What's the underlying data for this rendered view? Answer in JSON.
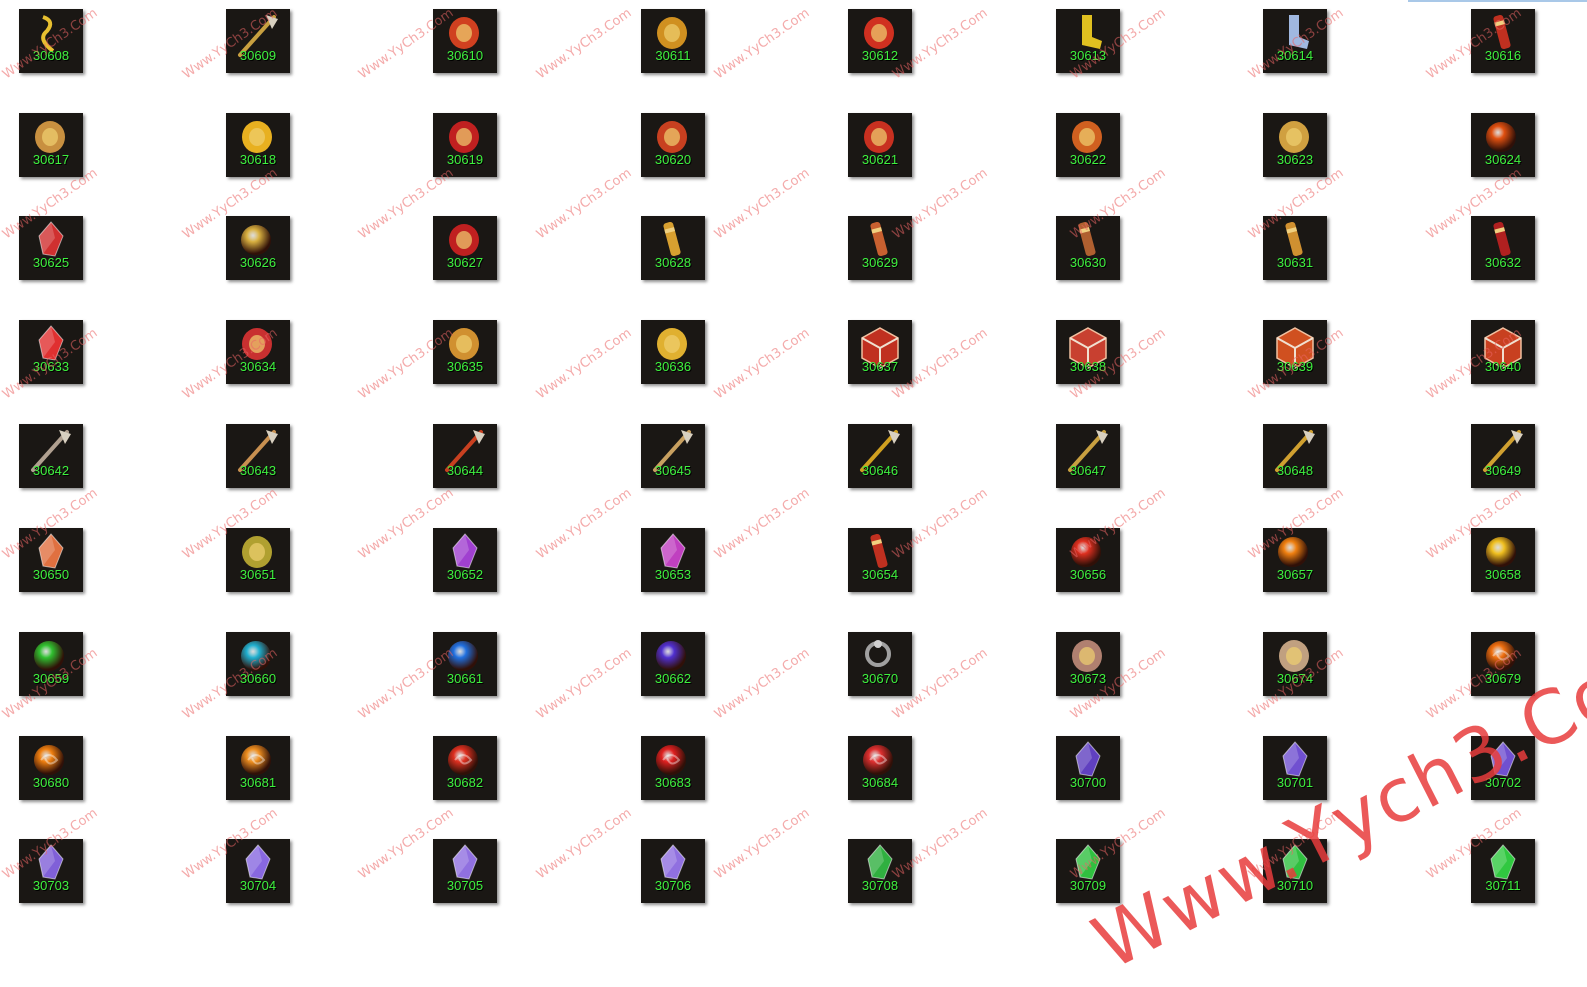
{
  "items": [
    {
      "id": "30608",
      "icon": "ribbon-icon",
      "color": "#e8c030"
    },
    {
      "id": "30609",
      "icon": "wand-icon",
      "color": "#c8a040"
    },
    {
      "id": "30610",
      "icon": "flower-bundle-icon",
      "color": "#d04020"
    },
    {
      "id": "30611",
      "icon": "gold-emblem-icon",
      "color": "#d09020"
    },
    {
      "id": "30612",
      "icon": "red-seal-icon",
      "color": "#d03020"
    },
    {
      "id": "30613",
      "icon": "stocking-gold-icon",
      "color": "#e0c020"
    },
    {
      "id": "30614",
      "icon": "stocking-blue-icon",
      "color": "#a0b8e0"
    },
    {
      "id": "30616",
      "icon": "firecracker-icon",
      "color": "#c03020"
    },
    {
      "id": "30617",
      "icon": "treasure-chest-icon",
      "color": "#c89040"
    },
    {
      "id": "30618",
      "icon": "gold-ingot-icon",
      "color": "#e8b020"
    },
    {
      "id": "30619",
      "icon": "red-pouch-icon",
      "color": "#c02020"
    },
    {
      "id": "30620",
      "icon": "lucky-bag-icon",
      "color": "#c84020"
    },
    {
      "id": "30621",
      "icon": "chinese-knot-icon",
      "color": "#c83020"
    },
    {
      "id": "30622",
      "icon": "lantern-icon",
      "color": "#d06020"
    },
    {
      "id": "30623",
      "icon": "red-envelope-icon",
      "color": "#d0a040"
    },
    {
      "id": "30624",
      "icon": "fire-orb-icon",
      "color": "#e05010"
    },
    {
      "id": "30625",
      "icon": "red-gem-icon",
      "color": "#d03030"
    },
    {
      "id": "30626",
      "icon": "gold-sphere-icon",
      "color": "#d8b040"
    },
    {
      "id": "30627",
      "icon": "banner-shield-icon",
      "color": "#c02020"
    },
    {
      "id": "30628",
      "icon": "scroll-gold-icon",
      "color": "#d8a030"
    },
    {
      "id": "30629",
      "icon": "scroll-blue-icon",
      "color": "#c86030"
    },
    {
      "id": "30630",
      "icon": "scroll-red-icon",
      "color": "#b06030"
    },
    {
      "id": "30631",
      "icon": "scroll-amber-icon",
      "color": "#d09030"
    },
    {
      "id": "30632",
      "icon": "firecracker-bundle-icon",
      "color": "#b02020"
    },
    {
      "id": "30633",
      "icon": "ruby-icon",
      "color": "#e03030"
    },
    {
      "id": "30634",
      "icon": "winged-amulet-icon",
      "color": "#c83030"
    },
    {
      "id": "30635",
      "icon": "crest-shield-icon",
      "color": "#d09030"
    },
    {
      "id": "30636",
      "icon": "golden-ram-icon",
      "color": "#e0b030"
    },
    {
      "id": "30637",
      "icon": "red-cube-icon",
      "color": "#c03020"
    },
    {
      "id": "30638",
      "icon": "red-cube-silver-icon",
      "color": "#c84030"
    },
    {
      "id": "30639",
      "icon": "red-cube-gold-icon",
      "color": "#d05020"
    },
    {
      "id": "30640",
      "icon": "red-cube-star-icon",
      "color": "#c84020"
    },
    {
      "id": "30642",
      "icon": "battle-axe-icon",
      "color": "#b0a090"
    },
    {
      "id": "30643",
      "icon": "trident-icon",
      "color": "#c89050"
    },
    {
      "id": "30644",
      "icon": "flame-halberd-icon",
      "color": "#c84020"
    },
    {
      "id": "30645",
      "icon": "double-axe-icon",
      "color": "#c8a060"
    },
    {
      "id": "30646",
      "icon": "golden-blade-icon",
      "color": "#d0a020"
    },
    {
      "id": "30647",
      "icon": "scythe-icon",
      "color": "#c8a040"
    },
    {
      "id": "30648",
      "icon": "golden-spear-icon",
      "color": "#d0a030"
    },
    {
      "id": "30649",
      "icon": "longsword-icon",
      "color": "#d0a030"
    },
    {
      "id": "30650",
      "icon": "rainbow-crystal-icon",
      "color": "#e07040"
    },
    {
      "id": "30651",
      "icon": "green-rune-icon",
      "color": "#b0a030"
    },
    {
      "id": "30652",
      "icon": "purple-gem-icon",
      "color": "#a040d0"
    },
    {
      "id": "30653",
      "icon": "violet-gem-icon",
      "color": "#c040c0"
    },
    {
      "id": "30654",
      "icon": "red-scroll-tag-icon",
      "color": "#c03020"
    },
    {
      "id": "30656",
      "icon": "red-orb-icon",
      "color": "#e03020"
    },
    {
      "id": "30657",
      "icon": "orange-orb-icon",
      "color": "#f08010"
    },
    {
      "id": "30658",
      "icon": "yellow-orb-icon",
      "color": "#f0c020"
    },
    {
      "id": "30659",
      "icon": "green-orb-icon",
      "color": "#30c030"
    },
    {
      "id": "30660",
      "icon": "cyan-orb-icon",
      "color": "#20b0d0"
    },
    {
      "id": "30661",
      "icon": "blue-orb-icon",
      "color": "#2070e0"
    },
    {
      "id": "30662",
      "icon": "indigo-orb-icon",
      "color": "#5030d0"
    },
    {
      "id": "30670",
      "icon": "silver-ring-icon",
      "color": "#a0a0a0"
    },
    {
      "id": "30673",
      "icon": "stone-claw-icon",
      "color": "#b08070"
    },
    {
      "id": "30674",
      "icon": "bone-relic-icon",
      "color": "#c0a080"
    },
    {
      "id": "30679",
      "icon": "orange-swirl-orb-icon",
      "color": "#f07010"
    },
    {
      "id": "30680",
      "icon": "orange-swirl-orb-2-icon",
      "color": "#f08010"
    },
    {
      "id": "30681",
      "icon": "orange-swirl-orb-3-icon",
      "color": "#f09020"
    },
    {
      "id": "30682",
      "icon": "red-swirl-orb-icon",
      "color": "#e03020"
    },
    {
      "id": "30683",
      "icon": "red-swirl-orb-2-icon",
      "color": "#e02020"
    },
    {
      "id": "30684",
      "icon": "red-swirl-orb-3-icon",
      "color": "#e03030"
    },
    {
      "id": "30700",
      "icon": "small-amethyst-icon",
      "color": "#6040c0"
    },
    {
      "id": "30701",
      "icon": "amethyst-icon",
      "color": "#7050d0"
    },
    {
      "id": "30702",
      "icon": "amethyst-2-icon",
      "color": "#7050d0"
    },
    {
      "id": "30703",
      "icon": "amethyst-3-icon",
      "color": "#8060d8"
    },
    {
      "id": "30704",
      "icon": "amethyst-4-icon",
      "color": "#8868e0"
    },
    {
      "id": "30705",
      "icon": "amethyst-5-icon",
      "color": "#9070e0"
    },
    {
      "id": "30706",
      "icon": "amethyst-gold-icon",
      "color": "#9070e0"
    },
    {
      "id": "30708",
      "icon": "small-emerald-icon",
      "color": "#30b040"
    },
    {
      "id": "30709",
      "icon": "emerald-icon",
      "color": "#30c040"
    },
    {
      "id": "30710",
      "icon": "emerald-2-icon",
      "color": "#30c040"
    },
    {
      "id": "30711",
      "icon": "emerald-3-icon",
      "color": "#30c840"
    }
  ],
  "watermark": {
    "small_text": "Www.YyCh3.Com",
    "large_text": "Www.Yych3.Com"
  }
}
